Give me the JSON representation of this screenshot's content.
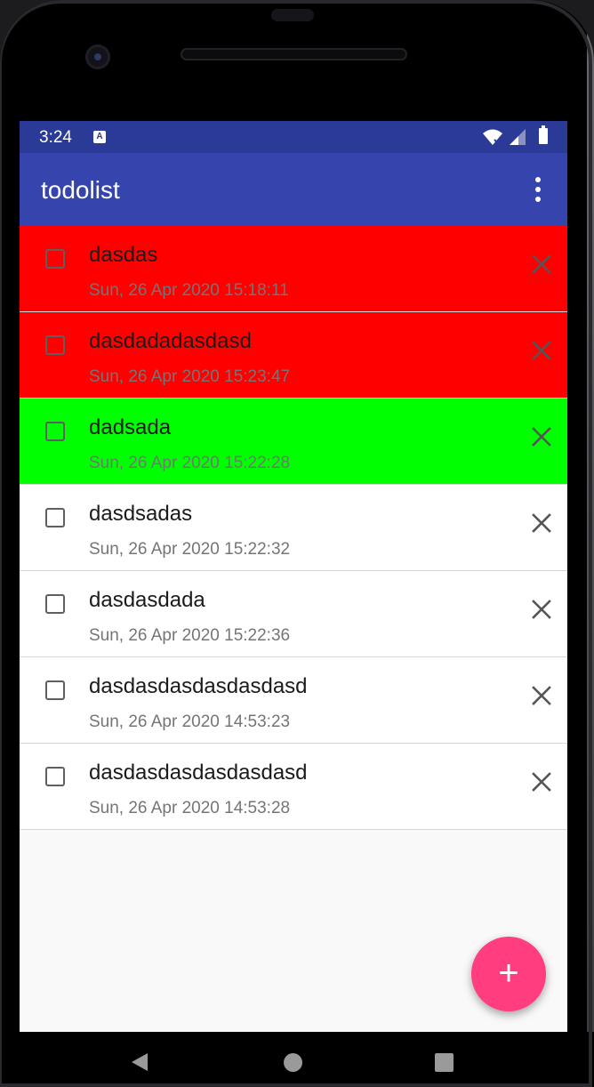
{
  "status_bar": {
    "time": "3:24",
    "notification_icon": "a-notification-icon",
    "icons": [
      "wifi-icon",
      "signal-icon",
      "battery-icon"
    ]
  },
  "app_bar": {
    "title": "todolist",
    "menu_icon": "more-vert-icon"
  },
  "colors": {
    "status_bar": "#2b3a96",
    "app_bar": "#3545ad",
    "item_red": "#ff0000",
    "item_green": "#00ff00",
    "item_default": "#ffffff",
    "fab": "#ff3d7f",
    "list_background": "#f9f9f9"
  },
  "todos": [
    {
      "title": "dasdas",
      "date": "Sun, 26 Apr 2020 15:18:11",
      "color": "#ff0000",
      "checked": false
    },
    {
      "title": "dasdadadasdasd",
      "date": "Sun, 26 Apr 2020 15:23:47",
      "color": "#ff0000",
      "checked": false
    },
    {
      "title": "dadsada",
      "date": "Sun, 26 Apr 2020 15:22:28",
      "color": "#00ff00",
      "checked": false
    },
    {
      "title": "dasdsadas",
      "date": "Sun, 26 Apr 2020 15:22:32",
      "color": "#ffffff",
      "checked": false
    },
    {
      "title": "dasdasdada",
      "date": "Sun, 26 Apr 2020 15:22:36",
      "color": "#ffffff",
      "checked": false
    },
    {
      "title": "dasdasdasdasdasdasd",
      "date": "Sun, 26 Apr 2020 14:53:23",
      "color": "#ffffff",
      "checked": false
    },
    {
      "title": "dasdasdasdasdasdasd",
      "date": "Sun, 26 Apr 2020 14:53:28",
      "color": "#ffffff",
      "checked": false
    }
  ],
  "fab": {
    "label": "+",
    "icon": "add-icon"
  },
  "nav_bar": {
    "icons": [
      "back-icon",
      "home-icon",
      "recents-icon"
    ]
  }
}
